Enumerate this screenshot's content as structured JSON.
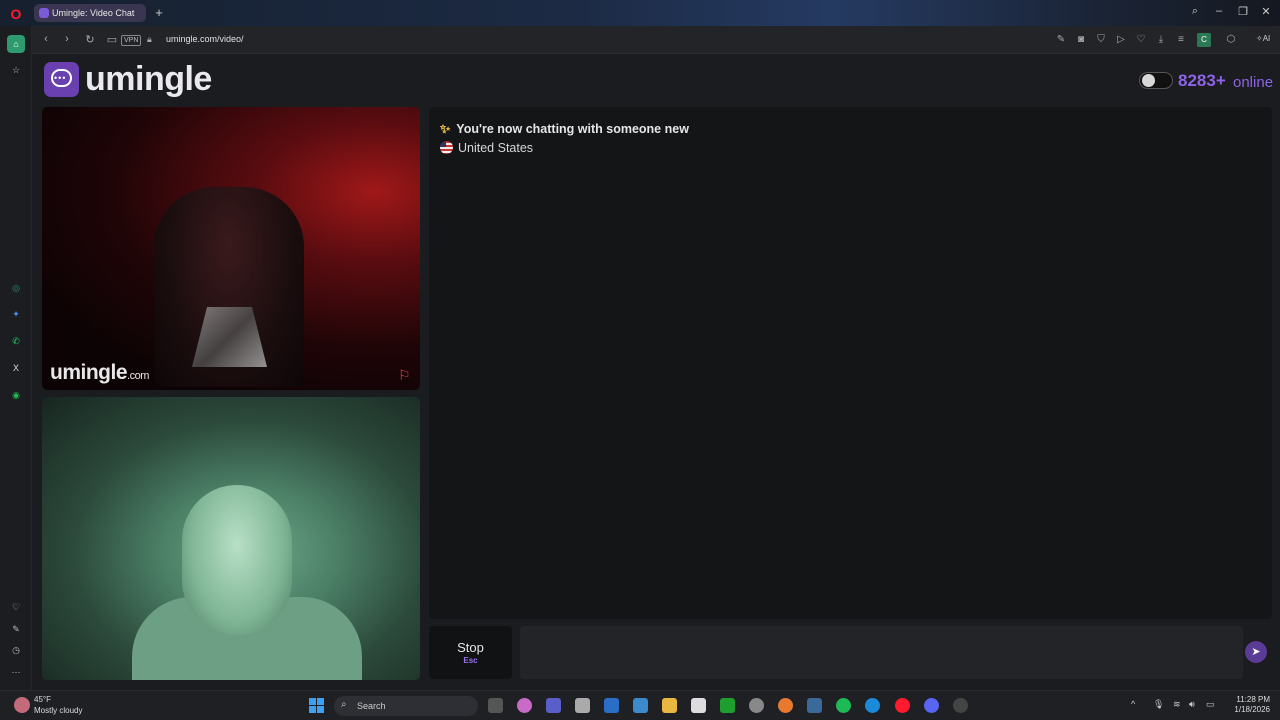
{
  "browser": {
    "tab_title": "Umingle: Video Chat",
    "url": "umingle.com/video/",
    "vpn_label": "VPN",
    "ai_label": "AI",
    "ext_badge": "C"
  },
  "site": {
    "logo_text": "umingle",
    "online_count": "8283+",
    "online_label": "online",
    "watermark_main": "umingle",
    "watermark_suffix": ".com"
  },
  "chat": {
    "status_message": "You're now chatting with someone new",
    "country": "United States"
  },
  "controls": {
    "stop_label": "Stop",
    "stop_key": "Esc",
    "message_placeholder": ""
  },
  "taskbar": {
    "temperature": "45°F",
    "condition": "Mostly cloudy",
    "search_label": "Search",
    "time": "11:28 PM",
    "date": "1/18/2026"
  },
  "colors": {
    "accent": "#8e63e8",
    "logo_bg": "#6a3fb0"
  }
}
